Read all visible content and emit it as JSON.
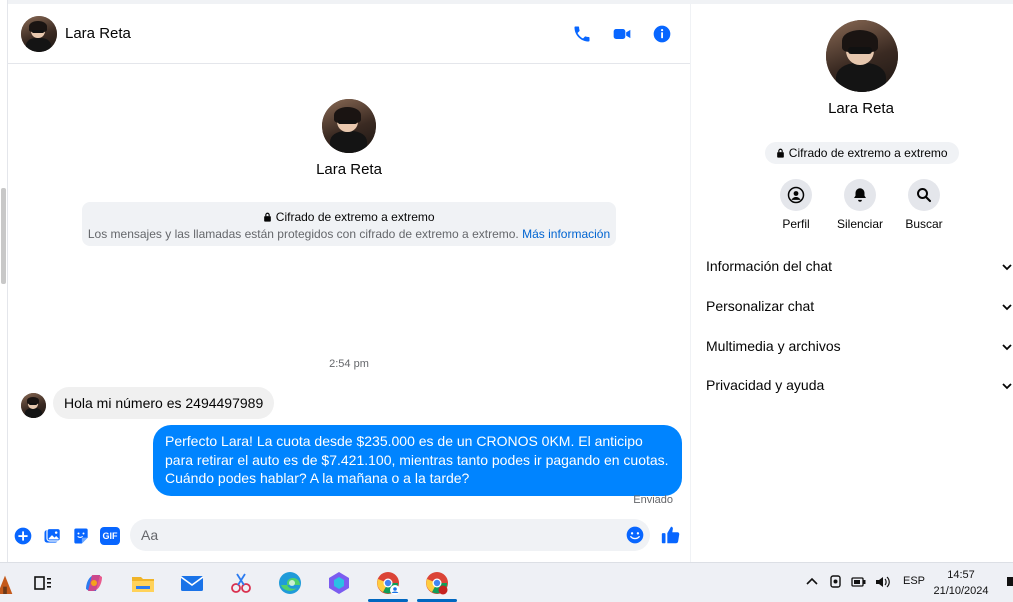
{
  "header": {
    "contact_name": "Lara Reta",
    "icons": [
      "phone-icon",
      "video-icon",
      "info-icon"
    ]
  },
  "intro": {
    "contact_name": "Lara Reta",
    "e2e_title": "Cifrado de extremo a extremo",
    "e2e_text": "Los mensajes y las llamadas están protegidos con cifrado de extremo a extremo.",
    "e2e_link": "Más información"
  },
  "conversation": {
    "timestamp": "2:54 pm",
    "incoming_message": "Hola mi número es 2494497989",
    "outgoing_message": "Perfecto Lara! La cuota desde $235.000 es de un CRONOS 0KM. El anticipo para retirar el auto es de $7.421.100, mientras tanto podes ir pagando en cuotas. Cuándo podes hablar? A la mañana o a la tarde?",
    "status": "Enviado"
  },
  "composer": {
    "placeholder": "Aa",
    "gif_label": "GIF",
    "icons": [
      "add-icon",
      "photo-icon",
      "sticker-icon",
      "gif-icon",
      "emoji-icon",
      "like-icon"
    ]
  },
  "info_panel": {
    "contact_name": "Lara Reta",
    "e2e_badge": "Cifrado de extremo a extremo",
    "actions": [
      {
        "label": "Perfil",
        "icon": "profile-icon"
      },
      {
        "label": "Silenciar",
        "icon": "bell-icon"
      },
      {
        "label": "Buscar",
        "icon": "search-icon"
      }
    ],
    "sections": [
      "Información del chat",
      "Personalizar chat",
      "Multimedia y archivos",
      "Privacidad y ayuda"
    ]
  },
  "taskbar": {
    "language": "ESP",
    "time": "14:57",
    "date": "21/10/2024"
  },
  "colors": {
    "accent": "#0084ff",
    "icon_blue": "#0866ff"
  }
}
